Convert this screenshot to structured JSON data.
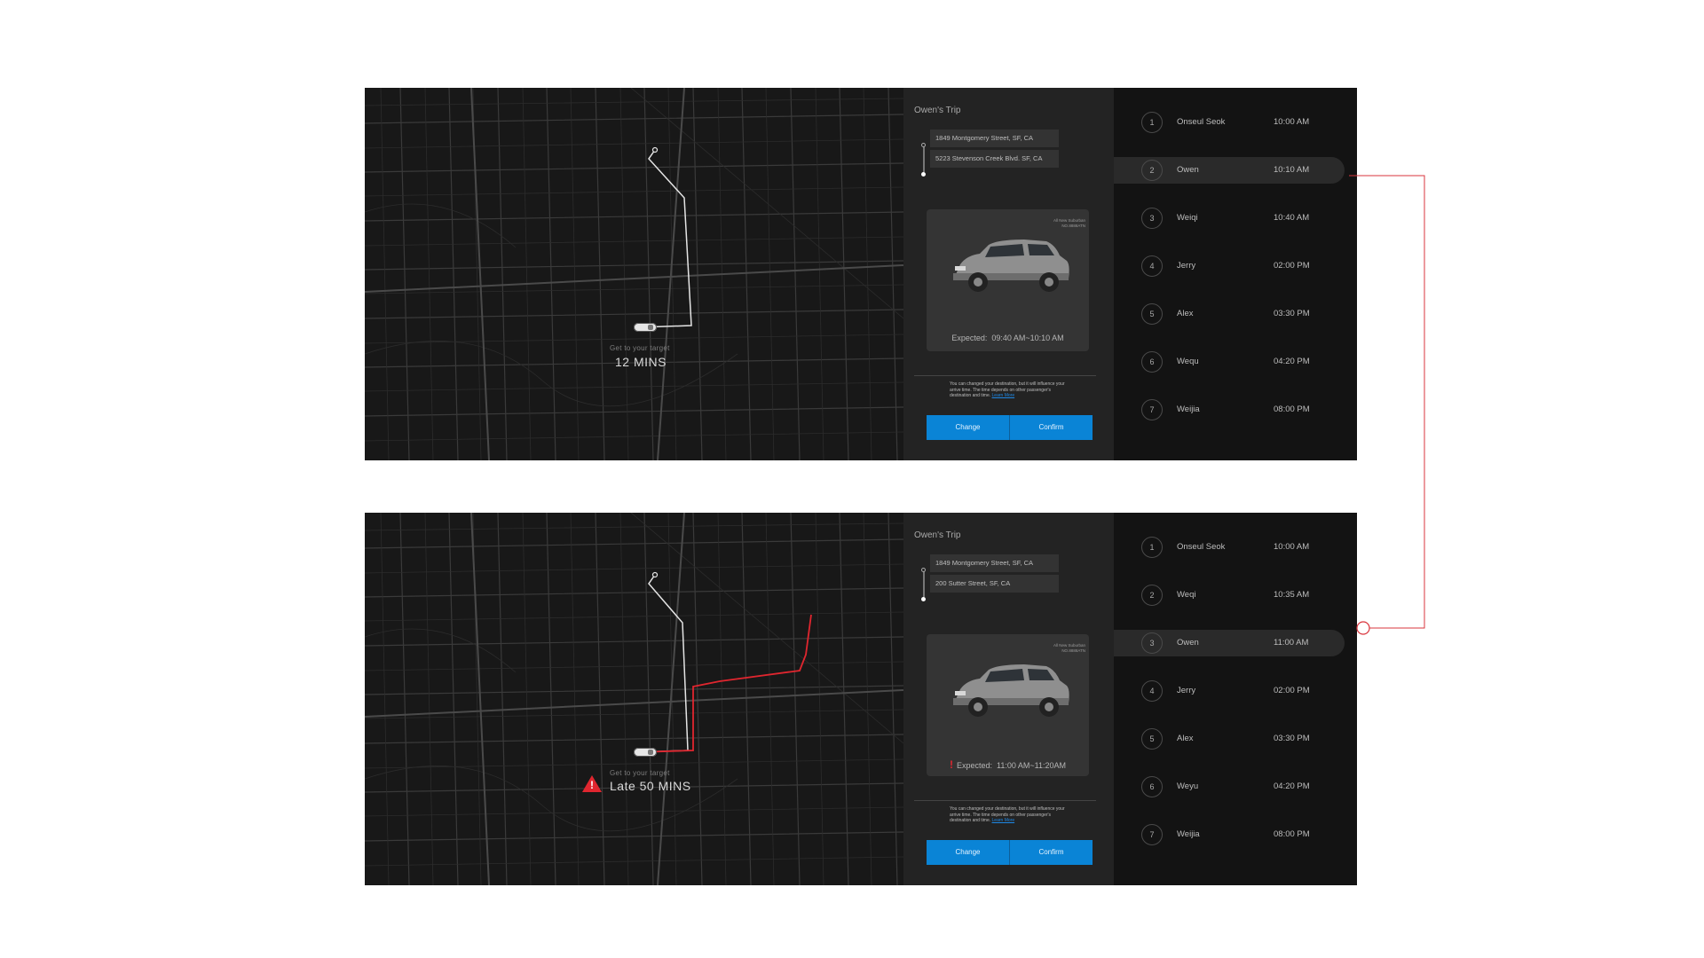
{
  "screens": [
    {
      "trip_title": "Owen's Trip",
      "from": "1849 Montgomery Street,  SF,  CA",
      "to": "5223 Stevenson Creek Blvd. SF,  CA",
      "card_tag": "All New Suburban NO.8888ATN",
      "expected_label": "Expected:",
      "expected_value": "09:40 AM~10:10 AM",
      "note": "You can changed your destination, but it will influence your arrive time. The time depends on other passenger's destination and time.",
      "note_link": "Learn More",
      "change_label": "Change",
      "confirm_label": "Confirm",
      "eta_small": "Get to your target",
      "eta_big": "12 MINS",
      "queue": [
        {
          "num": "1",
          "name": "Onseul Seok",
          "time": "10:00 AM"
        },
        {
          "num": "2",
          "name": "Owen",
          "time": "10:10 AM"
        },
        {
          "num": "3",
          "name": "Weiqi",
          "time": "10:40 AM"
        },
        {
          "num": "4",
          "name": "Jerry",
          "time": "02:00 PM"
        },
        {
          "num": "5",
          "name": "Alex",
          "time": "03:30 PM"
        },
        {
          "num": "6",
          "name": "Wequ",
          "time": "04:20 PM"
        },
        {
          "num": "7",
          "name": "Weijia",
          "time": "08:00 PM"
        }
      ],
      "active_index": 1
    },
    {
      "trip_title": "Owen's Trip",
      "from": "1849 Montgomery Street,  SF,  CA",
      "to": "200 Sutter Street,  SF,  CA",
      "card_tag": "All New Suburban NO.8888ATN",
      "expected_label": "Expected:",
      "expected_value": "11:00 AM~11:20AM",
      "note": "You can changed your destination, but it will influence your arrive time. The time depends on other passenger's destination and time.",
      "note_link": "Learn More",
      "change_label": "Change",
      "confirm_label": "Confirm",
      "eta_small": "Get to your target",
      "eta_big": "Late 50 MINS",
      "queue": [
        {
          "num": "1",
          "name": "Onseul Seok",
          "time": "10:00 AM"
        },
        {
          "num": "2",
          "name": "Weqi",
          "time": "10:35 AM"
        },
        {
          "num": "3",
          "name": "Owen",
          "time": "11:00 AM"
        },
        {
          "num": "4",
          "name": "Jerry",
          "time": "02:00 PM"
        },
        {
          "num": "5",
          "name": "Alex",
          "time": "03:30 PM"
        },
        {
          "num": "6",
          "name": "Weyu",
          "time": "04:20 PM"
        },
        {
          "num": "7",
          "name": "Weijia",
          "time": "08:00 PM"
        }
      ],
      "active_index": 2
    }
  ],
  "colors": {
    "accent": "#0a84d6",
    "alert": "#e0262f",
    "connector": "#d9343c"
  }
}
